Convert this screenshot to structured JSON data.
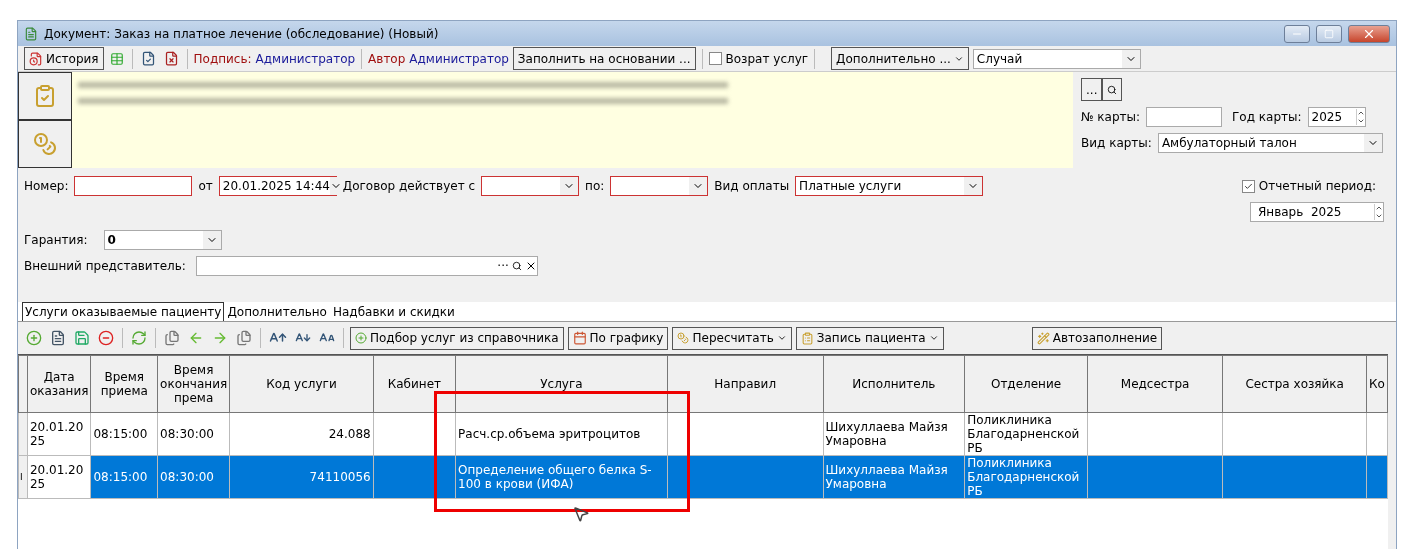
{
  "window": {
    "title": "Документ: Заказ на платное лечение (обследование) (Новый)"
  },
  "toolbar": {
    "history": "История",
    "sign_label": "Подпись:",
    "sign_value": "Администратор",
    "author_label": "Автор",
    "author_value": "Администратор",
    "fill_button": "Заполнить на основании ...",
    "return": {
      "label": "Возрат услуг",
      "checked": false
    },
    "more_button": "Дополнительно ...",
    "case_select": "Случай"
  },
  "card": {
    "number_label": "№ карты:",
    "year_label": "Год карты:",
    "year": "2025",
    "type_label": "Вид карты:",
    "type": "Амбулаторный талон",
    "browse": "..."
  },
  "form": {
    "number_label": "Номер:",
    "from_label": "от",
    "date": "20.01.2025 14:44",
    "contract_label": "Договор действует с",
    "to_label": "по:",
    "payment_label": "Вид оплаты",
    "payment": "Платные услуги",
    "period": {
      "label": "Отчетный период:",
      "checked": true
    },
    "period_month": "Январь",
    "period_year": "2025",
    "guarantee_label": "Гарантия:",
    "guarantee": "0",
    "rep_label": "Внешний представитель:",
    "rep_browse": "···"
  },
  "tabs": [
    {
      "label": "Услуги оказываемые пациенту",
      "selected": true
    },
    {
      "label": "Дополнительно",
      "selected": false
    },
    {
      "label": "Надбавки и скидки",
      "selected": false
    }
  ],
  "grid_toolbar": {
    "pick": "Подбор услуг из справочника",
    "schedule": "По графику",
    "recalc": "Пересчитать",
    "record": "Запись пациента",
    "autofill": "Автозаполнение"
  },
  "table": {
    "columns": [
      "Дата оказания",
      "Время приема",
      "Время окончания према",
      "Код услуги",
      "Кабинет",
      "Услуга",
      "Направил",
      "Исполнитель",
      "Отделение",
      "Медсестра",
      "Сестра хозяйка",
      "Ко"
    ],
    "rows": [
      {
        "selected": false,
        "cells": [
          "20.01.2025",
          "08:15:00",
          "08:30:00",
          "24.088",
          "",
          "Расч.ср.объема эритроцитов",
          "",
          "Шихуллаева Майзя Умаровна",
          "Поликлиника Благодарненской РБ",
          "",
          "",
          ""
        ]
      },
      {
        "selected": true,
        "indicator": "I",
        "cells": [
          "20.01.2025",
          "08:15:00",
          "08:30:00",
          "74110056",
          "",
          "Определение общего белка S-100 в крови (ИФА)",
          "",
          "Шихуллаева Майзя Умаровна",
          "Поликлиника Благодарненской РБ",
          "",
          "",
          ""
        ]
      }
    ]
  }
}
